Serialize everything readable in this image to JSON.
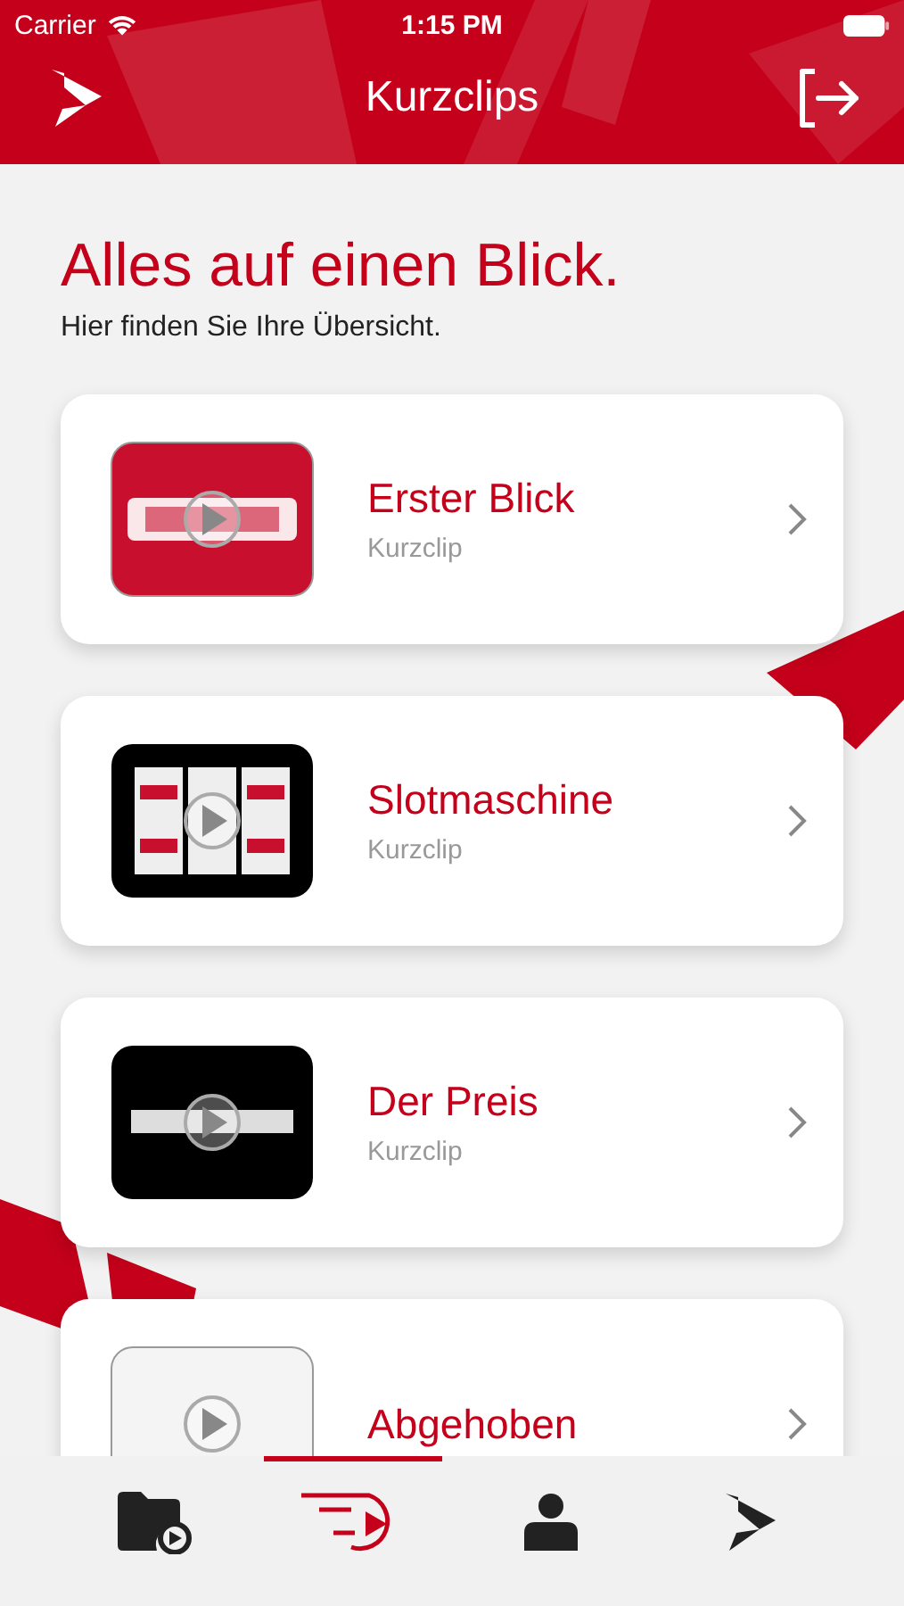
{
  "status_bar": {
    "carrier": "Carrier",
    "time": "1:15 PM"
  },
  "nav": {
    "title": "Kurzclips"
  },
  "header": {
    "title": "Alles auf einen Blick.",
    "subtitle": "Hier finden Sie Ihre Übersicht."
  },
  "clips": [
    {
      "title": "Erster Blick",
      "subtitle": "Kurzclip"
    },
    {
      "title": "Slotmaschine",
      "subtitle": "Kurzclip"
    },
    {
      "title": "Der Preis",
      "subtitle": "Kurzclip"
    },
    {
      "title": "Abgehoben"
    }
  ],
  "tabs": [
    {
      "kind": "folder",
      "selected": false
    },
    {
      "kind": "clips",
      "selected": true
    },
    {
      "kind": "profile",
      "selected": false
    },
    {
      "kind": "logo",
      "selected": false
    }
  ]
}
